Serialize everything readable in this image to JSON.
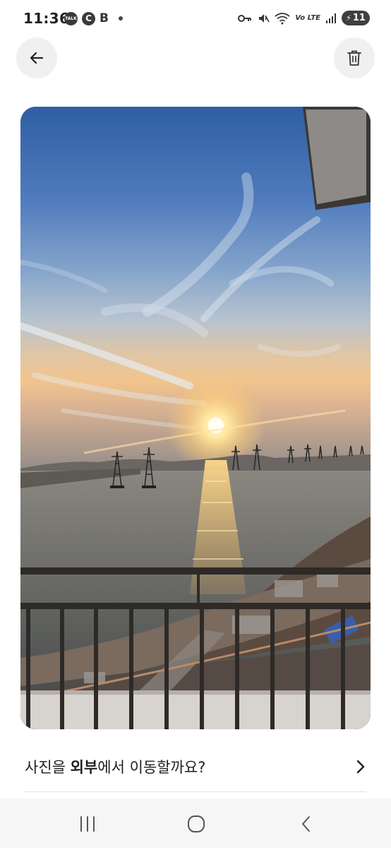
{
  "status_bar": {
    "time": "11:36",
    "talk_label": "TALK",
    "c_label": "C",
    "b_label": "B",
    "battery": "11",
    "network_label": "Vo LTE"
  },
  "icons": {
    "back": "arrow-left-icon",
    "delete": "trash-icon",
    "chevron": "chevron-right-icon",
    "nav_recent": "recent-apps-icon",
    "nav_home": "home-icon",
    "nav_back": "nav-back-icon"
  },
  "prompt": {
    "text_before": "사진을 ",
    "text_bold": "외부",
    "text_after": "에서 이동할까요?"
  },
  "photo": {
    "subject": "sunset-over-water-from-balcony"
  }
}
